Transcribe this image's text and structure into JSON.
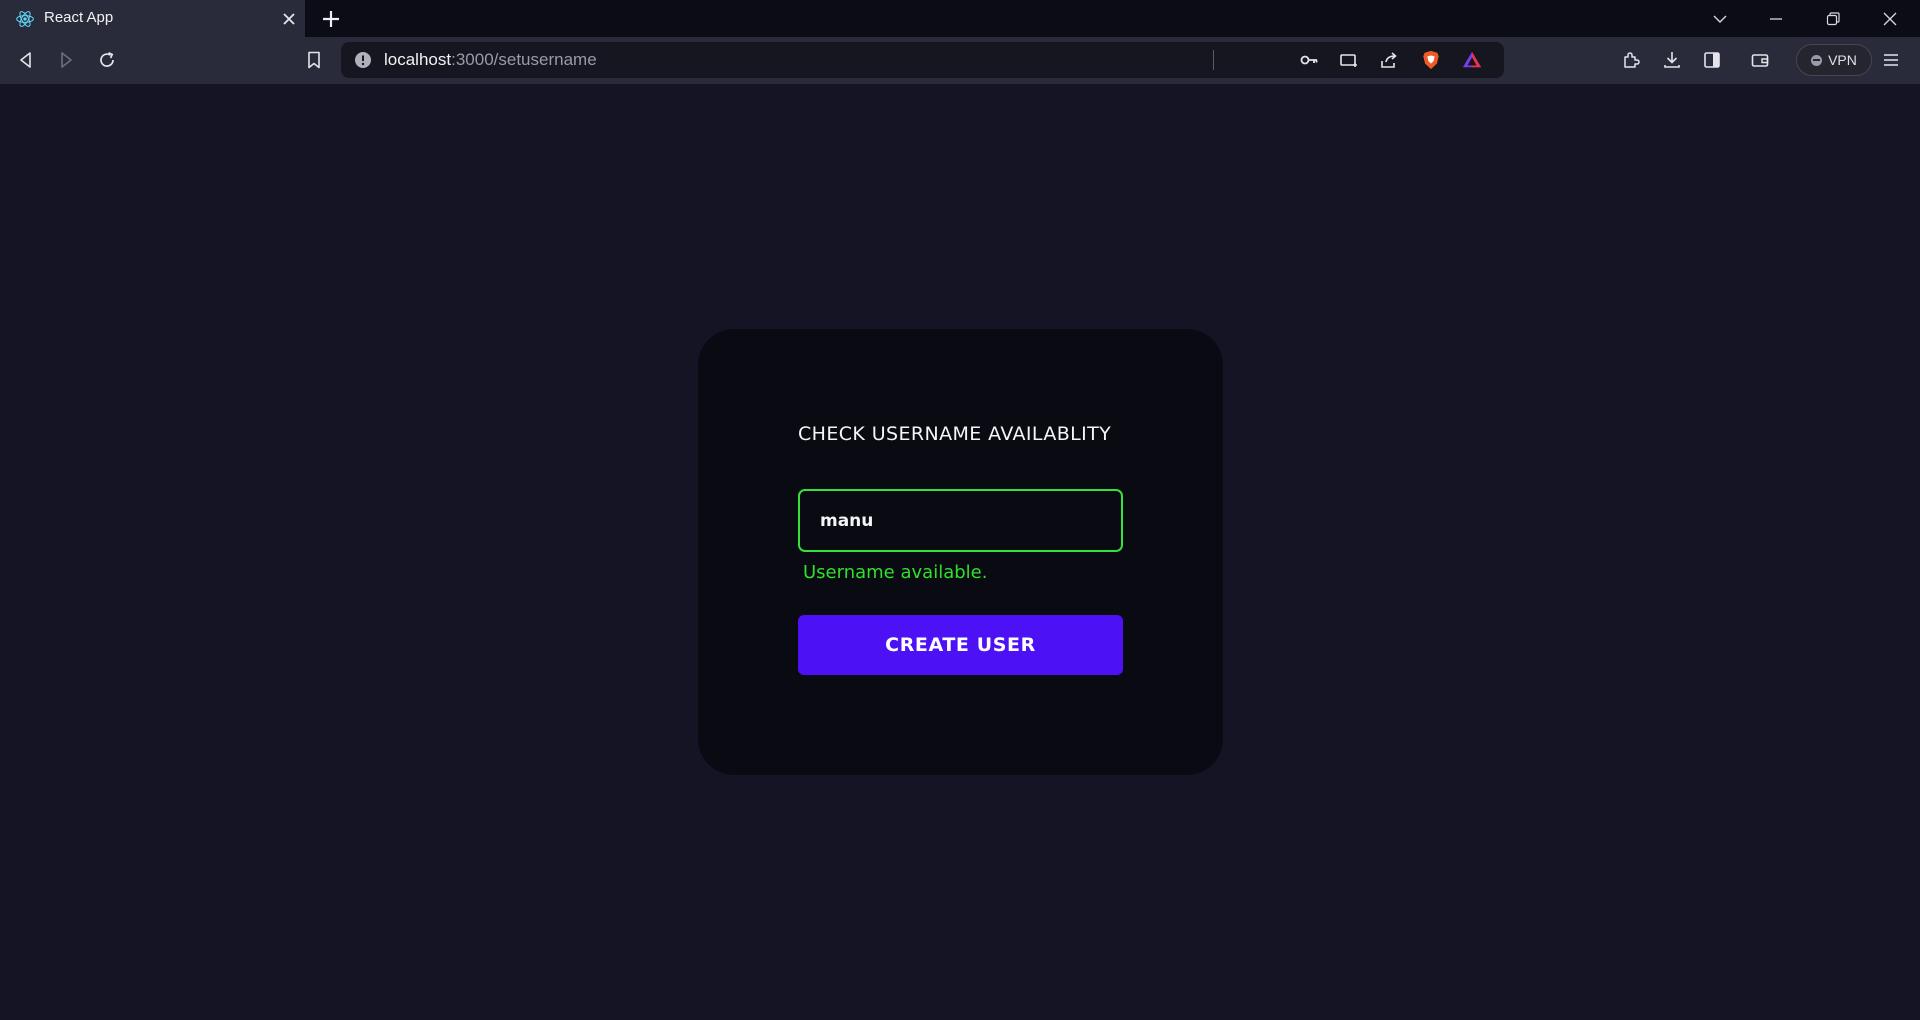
{
  "browser": {
    "tab": {
      "title": "React App",
      "icon": "react-icon"
    },
    "address": {
      "host": "localhost",
      "path": ":3000/setusername"
    },
    "vpn_label": "VPN",
    "colors": {
      "tab_active": "#2a2b3a",
      "toolbar": "#2a2b3a",
      "tabstrip": "#0c0c16"
    }
  },
  "page": {
    "card": {
      "title": "CHECK USERNAME AVAILABLITY",
      "username_value": "manu",
      "status_message": "Username available.",
      "button_label": "CREATE USER"
    },
    "colors": {
      "background": "#141424",
      "card": "#090a12",
      "success": "#2fe02c",
      "button": "#4c12f5"
    }
  }
}
